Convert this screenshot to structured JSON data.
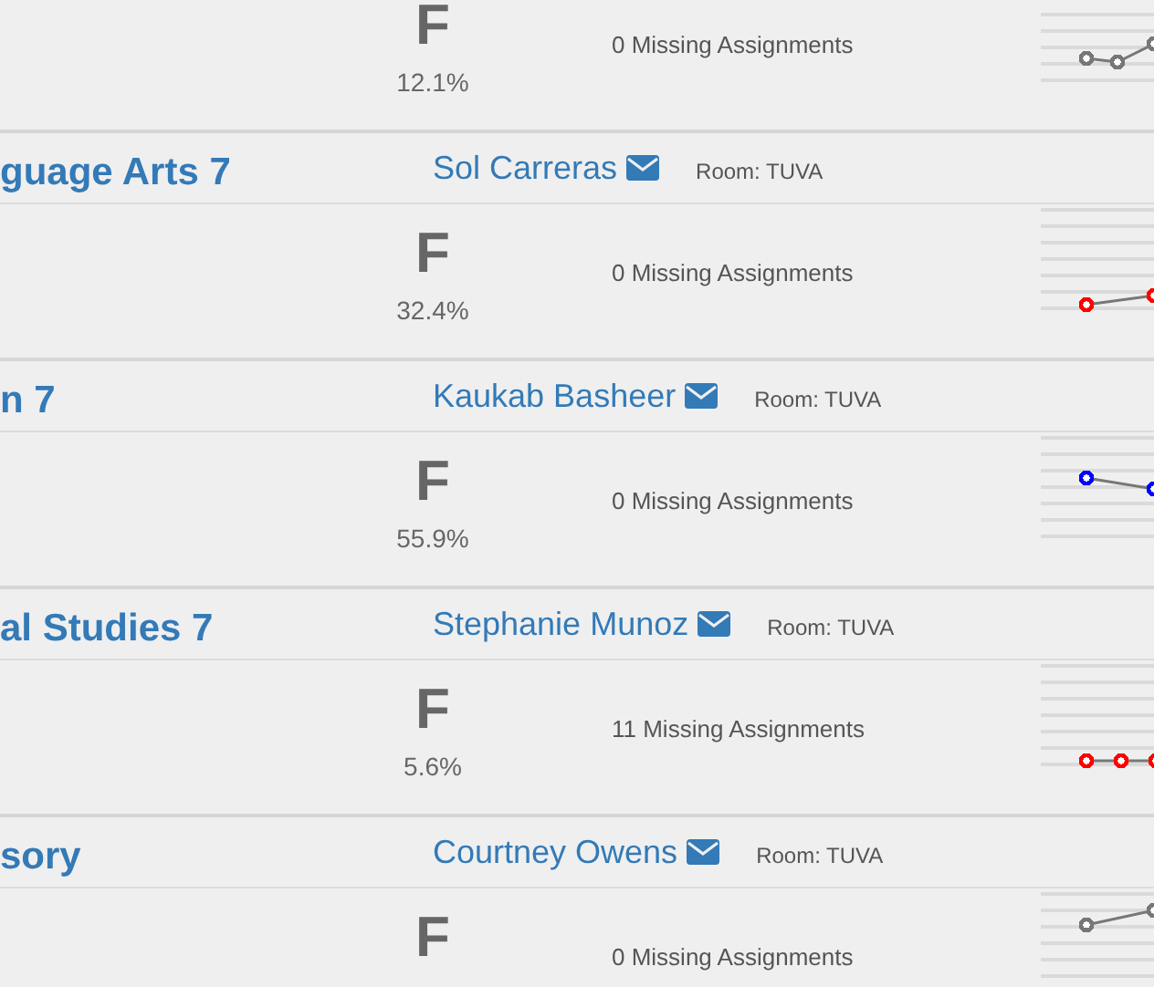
{
  "courses": [
    {
      "grade": "F",
      "percent": "12.1%",
      "missing": "0 Missing Assignments",
      "trend": {
        "kind": "dip",
        "color": "#777777"
      }
    },
    {
      "title": "guage Arts 7",
      "teacher": "Sol Carreras",
      "room": "Room: TUVA",
      "grade": "F",
      "percent": "32.4%",
      "missing": "0 Missing Assignments",
      "trend": {
        "kind": "up",
        "color": "#ff0000"
      }
    },
    {
      "title": "n 7",
      "teacher": "Kaukab Basheer",
      "room": "Room: TUVA",
      "grade": "F",
      "percent": "55.9%",
      "missing": "0 Missing Assignments",
      "trend": {
        "kind": "down",
        "color": "#0000ff"
      }
    },
    {
      "title": "al Studies 7",
      "teacher": "Stephanie Munoz",
      "room": "Room: TUVA",
      "grade": "F",
      "percent": "5.6%",
      "missing": "11 Missing Assignments",
      "trend": {
        "kind": "flat",
        "color": "#ff0000"
      }
    },
    {
      "title": "sory",
      "teacher": "Courtney Owens",
      "room": "Room: TUVA",
      "grade": "F",
      "missing": "0 Missing Assignments",
      "trend": {
        "kind": "up",
        "color": "#777777"
      }
    }
  ]
}
